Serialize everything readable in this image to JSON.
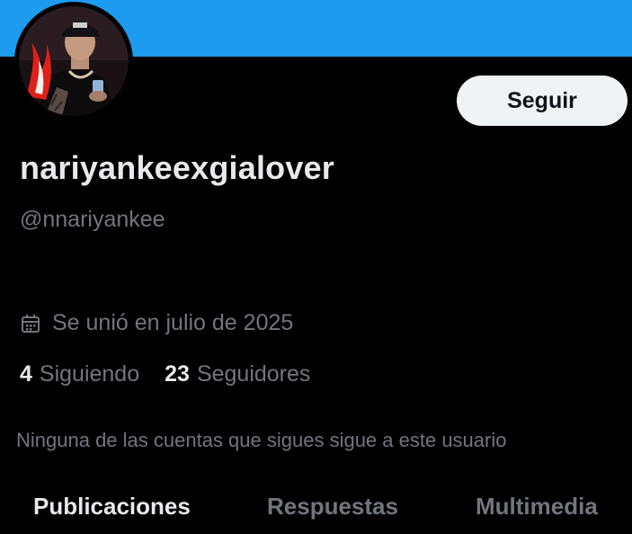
{
  "colors": {
    "banner": "#1d9bf0",
    "background": "#000000",
    "primary_text": "#e7e9ea",
    "secondary_text": "#71767b",
    "follow_button_bg": "#eff3f4",
    "follow_button_text": "#0f1419"
  },
  "profile": {
    "display_name": "nariyankeexgialover",
    "handle": "@nnariyankee",
    "joined": "Se unió en julio de 2025",
    "joined_icon": "calendar-icon",
    "following_count": "4",
    "following_label": "Siguiendo",
    "followers_count": "23",
    "followers_label": "Seguidores",
    "followers_note": "Ninguna de las cuentas que sigues sigue a este usuario"
  },
  "actions": {
    "follow_label": "Seguir"
  },
  "tabs": [
    {
      "label": "Publicaciones",
      "active": true
    },
    {
      "label": "Respuestas",
      "active": false
    },
    {
      "label": "Multimedia",
      "active": false
    }
  ]
}
